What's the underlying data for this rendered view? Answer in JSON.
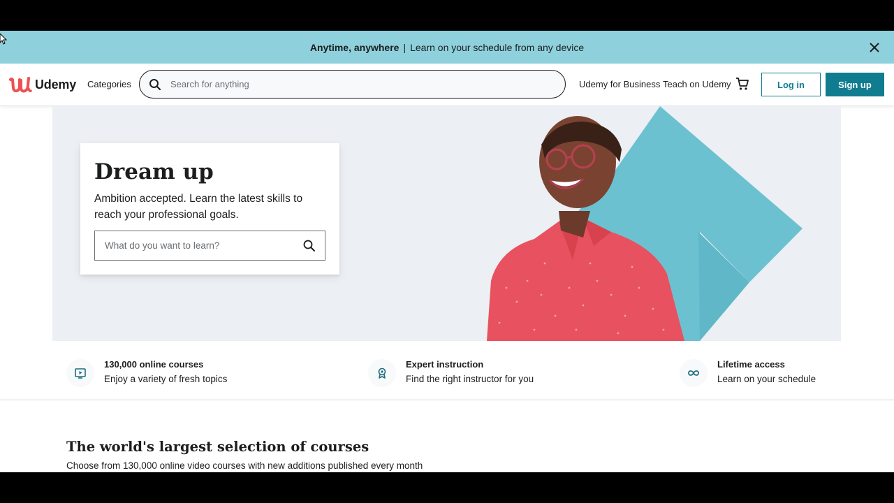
{
  "banner": {
    "strong": "Anytime, anywhere",
    "separator": "|",
    "message": "Learn on your schedule from any device",
    "close_icon": "close-icon"
  },
  "header": {
    "logo_text": "Udemy",
    "categories": "Categories",
    "search_placeholder": "Search for anything",
    "business_link": "Udemy for Business",
    "teach_link": "Teach on Udemy",
    "cart_icon": "cart-icon",
    "login_label": "Log in",
    "signup_label": "Sign up"
  },
  "hero": {
    "title": "Dream up",
    "subtitle": "Ambition accepted. Learn the latest skills to reach your professional goals.",
    "search_placeholder": "What do you want to learn?"
  },
  "props": [
    {
      "icon": "play-icon",
      "title": "130,000 online courses",
      "subtitle": "Enjoy a variety of fresh topics"
    },
    {
      "icon": "award-icon",
      "title": "Expert instruction",
      "subtitle": "Find the right instructor for you"
    },
    {
      "icon": "infinity-icon",
      "title": "Lifetime access",
      "subtitle": "Learn on your schedule"
    }
  ],
  "section": {
    "title": "The world's largest selection of courses",
    "subtitle": "Choose from 130,000 online video courses with new additions published every month"
  },
  "colors": {
    "banner_bg": "#8ed1dc",
    "brand_teal": "#0f7c90",
    "brand_red": "#ec5252",
    "hero_bg": "#eceff3",
    "arrow": "#6cc1d0",
    "shirt": "#e8515f"
  }
}
